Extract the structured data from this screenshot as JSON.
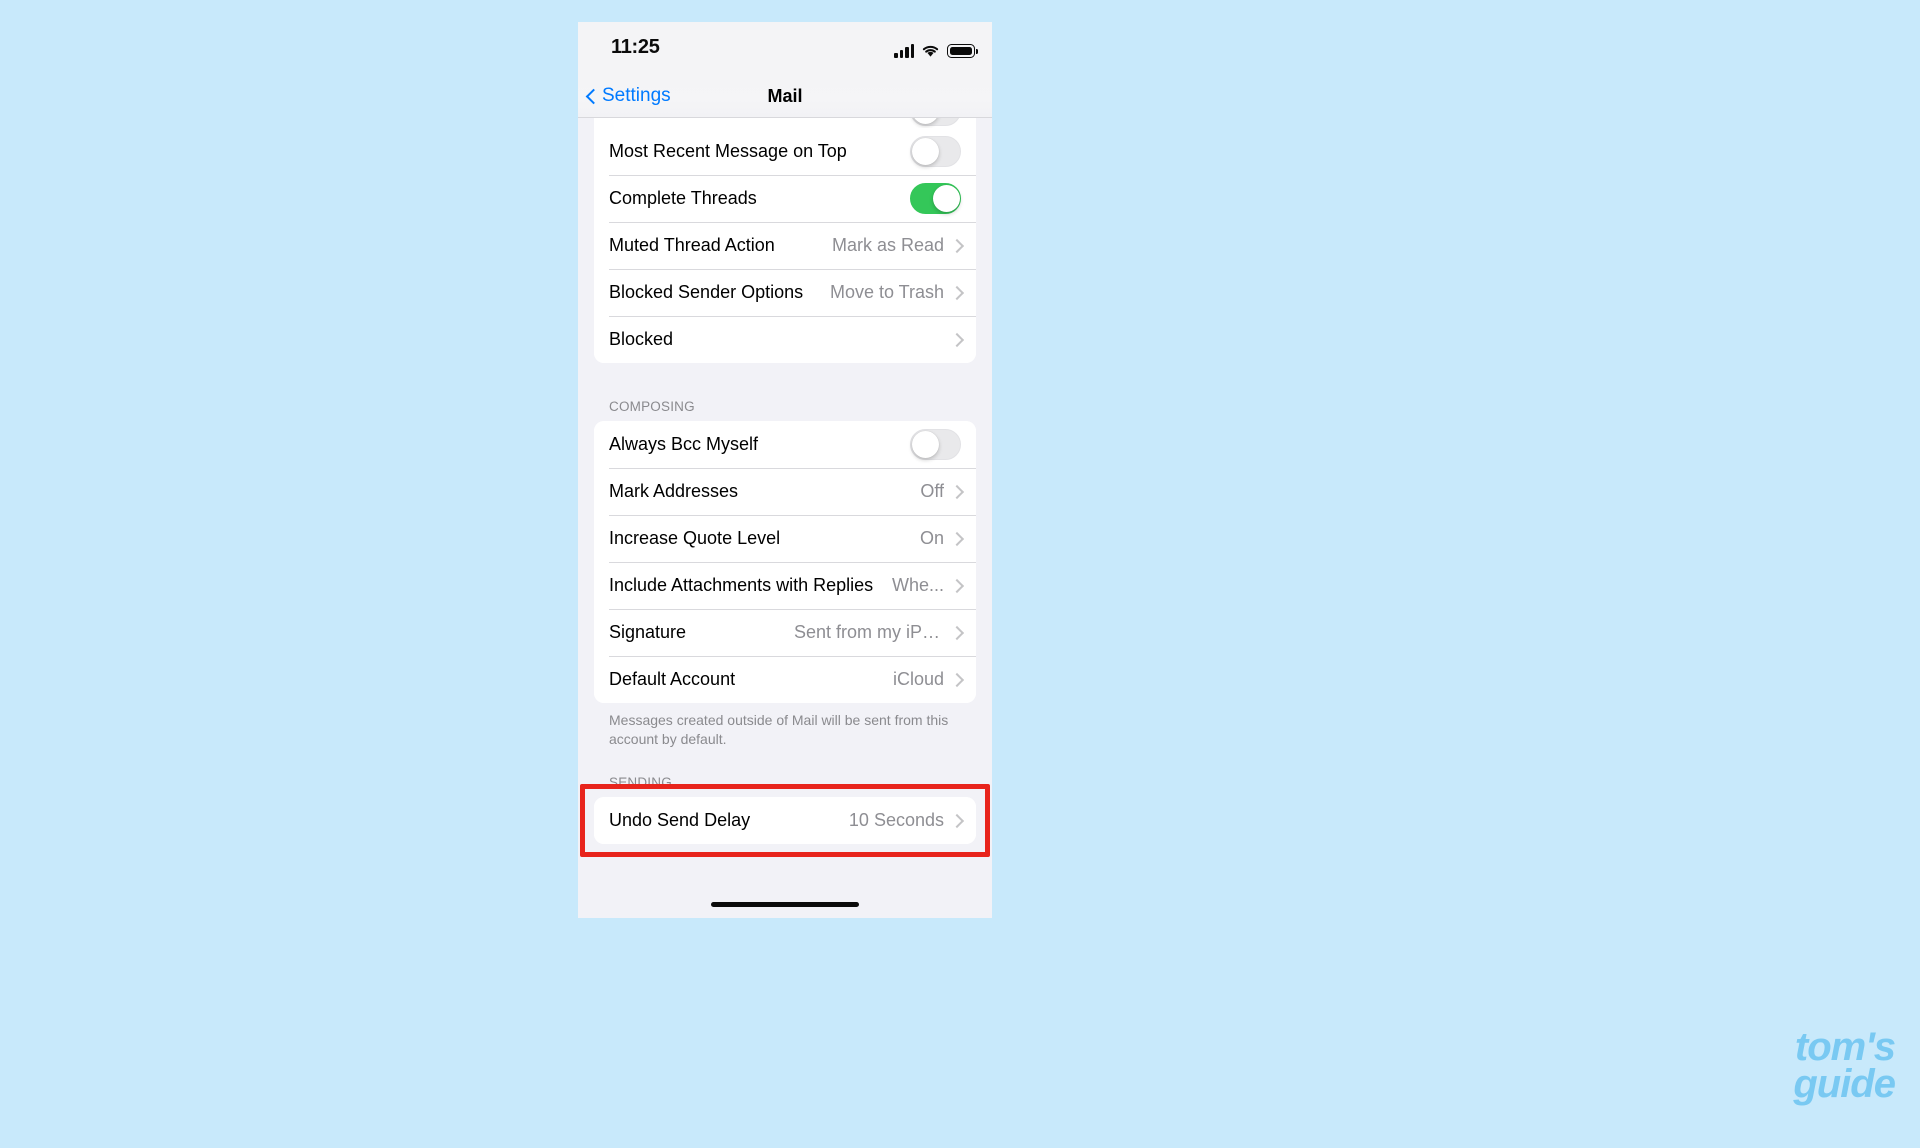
{
  "background_color": "#c8e9fb",
  "watermark": {
    "line1": "tom's",
    "line2": "guide",
    "color": "#79c9f2"
  },
  "phone": {
    "status_bar": {
      "time": "11:25",
      "icons": [
        "cellular-signal-icon",
        "wifi-icon",
        "battery-icon"
      ]
    },
    "nav_bar": {
      "back_label": "Settings",
      "back_icon": "chevron-left-icon",
      "title": "Mail"
    },
    "sections": [
      {
        "id": "threading",
        "header": "",
        "rows": [
          {
            "label": "Most Recent Message on Top",
            "control": "toggle",
            "value": "off"
          },
          {
            "label": "Complete Threads",
            "control": "toggle",
            "value": "on"
          },
          {
            "label": "Muted Thread Action",
            "control": "disclosure",
            "value": "Mark as Read"
          },
          {
            "label": "Blocked Sender Options",
            "control": "disclosure",
            "value": "Move to Trash"
          },
          {
            "label": "Blocked",
            "control": "disclosure",
            "value": ""
          }
        ],
        "footer": ""
      },
      {
        "id": "composing",
        "header": "COMPOSING",
        "rows": [
          {
            "label": "Always Bcc Myself",
            "control": "toggle",
            "value": "off"
          },
          {
            "label": "Mark Addresses",
            "control": "disclosure",
            "value": "Off"
          },
          {
            "label": "Increase Quote Level",
            "control": "disclosure",
            "value": "On"
          },
          {
            "label": "Include Attachments with Replies",
            "control": "disclosure",
            "value": "Whe..."
          },
          {
            "label": "Signature",
            "control": "disclosure",
            "value": "Sent from my iPhone"
          },
          {
            "label": "Default Account",
            "control": "disclosure",
            "value": "iCloud"
          }
        ],
        "footer": "Messages created outside of Mail will be sent from this account by default."
      },
      {
        "id": "sending",
        "header": "SENDING",
        "rows": [
          {
            "label": "Undo Send Delay",
            "control": "disclosure",
            "value": "10 Seconds",
            "highlighted": true
          }
        ],
        "footer": ""
      }
    ],
    "highlight_color": "#e8241c",
    "accent_color": "#007aff",
    "toggle_on_color": "#34c759"
  }
}
